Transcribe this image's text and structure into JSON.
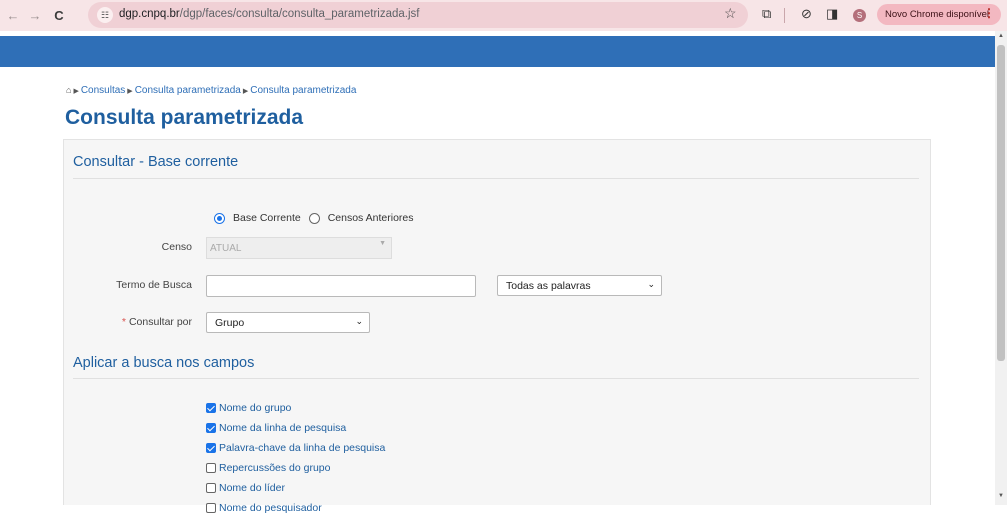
{
  "browser": {
    "url_host": "dgp.cnpq.br",
    "url_path": "/dgp/faces/consulta/consulta_parametrizada.jsf",
    "profile_initial": "S",
    "update_label": "Novo Chrome disponível"
  },
  "breadcrumb": [
    "Consultas",
    "Consulta parametrizada",
    "Consulta parametrizada"
  ],
  "page_title": "Consulta parametrizada",
  "section1_title": "Consultar - Base corrente",
  "base": {
    "options": [
      "Base Corrente",
      "Censos Anteriores"
    ],
    "selected": "Base Corrente"
  },
  "censo": {
    "label": "Censo",
    "value": "ATUAL"
  },
  "termo": {
    "label": "Termo de Busca",
    "value": "",
    "mode": "Todas as palavras"
  },
  "consultar_por": {
    "label": "Consultar por",
    "value": "Grupo"
  },
  "section2_title": "Aplicar a busca nos campos",
  "campos": [
    {
      "label": "Nome do grupo",
      "checked": true
    },
    {
      "label": "Nome da linha de pesquisa",
      "checked": true
    },
    {
      "label": "Palavra-chave da linha de pesquisa",
      "checked": true
    },
    {
      "label": "Repercussões do grupo",
      "checked": false
    },
    {
      "label": "Nome do líder",
      "checked": false
    },
    {
      "label": "Nome do pesquisador",
      "checked": false
    }
  ],
  "colors": {
    "accent": "#2f6fb7",
    "title": "#1f5f9f",
    "required": "#d9534f"
  },
  "icons": {
    "back": "back-arrow-icon",
    "forward": "forward-arrow-icon",
    "reload": "reload-icon",
    "site_info": "tune-icon",
    "bookmark": "star-icon",
    "extensions": "puzzle-icon",
    "lens": "lens-icon",
    "sidepanel": "side-panel-icon",
    "home": "home-icon"
  }
}
